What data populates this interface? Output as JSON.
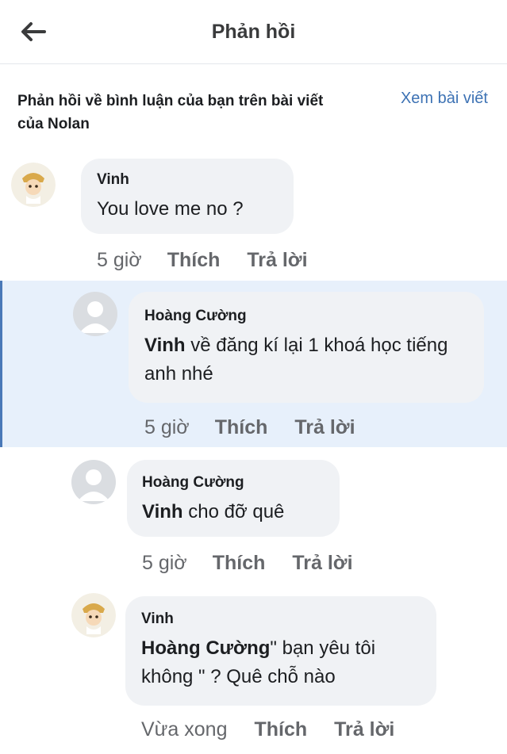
{
  "header": {
    "title": "Phản hồi"
  },
  "context": {
    "description": "Phản hồi về bình luận của bạn trên bài viết của Nolan",
    "view_post_link": "Xem bài viết"
  },
  "comments": [
    {
      "author": "Vinh",
      "mention": "",
      "text": "You love me no ?",
      "time": "5 giờ",
      "like_label": "Thích",
      "reply_label": "Trả lời"
    },
    {
      "author": "Hoàng Cường",
      "mention": "Vinh",
      "text": "về đăng kí lại 1 khoá học tiếng anh nhé",
      "time": "5 giờ",
      "like_label": "Thích",
      "reply_label": "Trả lời"
    },
    {
      "author": "Hoàng Cường",
      "mention": "Vinh",
      "text": "cho đỡ quê",
      "time": "5 giờ",
      "like_label": "Thích",
      "reply_label": "Trả lời"
    },
    {
      "author": "Vinh",
      "mention": "Hoàng Cường",
      "text": "\" bạn yêu tôi không \" ? Quê chỗ nào",
      "time": "Vừa xong",
      "like_label": "Thích",
      "reply_label": "Trả lời"
    }
  ]
}
